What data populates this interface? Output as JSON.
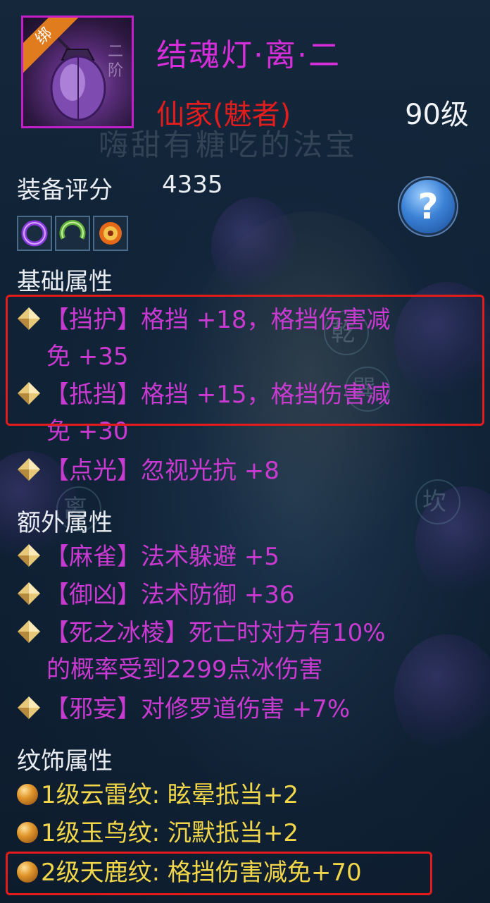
{
  "item": {
    "bind_tag": "绑",
    "name": "结魂灯·离·二",
    "class": "仙家(魅者)",
    "level": "90级",
    "watermark": "嗨甜有糖吃的法宝",
    "rank_glyph": "二阶",
    "rarity_color": "#c21fc8"
  },
  "score": {
    "label": "装备评分",
    "value": "4335"
  },
  "help": {
    "icon": "question-icon",
    "glyph": "?"
  },
  "gems": [
    {
      "icon": "purple-ring-gem-icon",
      "color": "#8a3be0"
    },
    {
      "icon": "green-ring-gem-icon",
      "color": "#5fae3a"
    },
    {
      "icon": "orange-orb-gem-icon",
      "color": "#e46a1a"
    }
  ],
  "base_section": {
    "title": "基础属性",
    "attrs": [
      {
        "line1": "【挡护】格挡 +18，格挡伤害减",
        "line2": "免 +35"
      },
      {
        "line1": "【抵挡】格挡 +15，格挡伤害减",
        "line2": "免 +30"
      },
      {
        "line1": "【点光】忽视光抗 +8",
        "line2": ""
      }
    ]
  },
  "extra_section": {
    "title": "额外属性",
    "attrs": [
      {
        "line1": "【麻雀】法术躲避 +5",
        "line2": ""
      },
      {
        "line1": "【御凶】法术防御 +36",
        "line2": ""
      },
      {
        "line1": "【死之冰棱】死亡时对方有10%",
        "line2": "的概率受到2299点冰伤害"
      },
      {
        "line1": "【邪妄】对修罗道伤害 +7%",
        "line2": ""
      }
    ]
  },
  "rune_section": {
    "title": "纹饰属性",
    "runes": [
      {
        "text": "1级云雷纹: 眩晕抵当+2"
      },
      {
        "text": "1级玉鸟纹: 沉默抵当+2"
      },
      {
        "text": "2级天鹿纹: 格挡伤害减免+70"
      }
    ]
  },
  "colors": {
    "attr": "#c83ad0",
    "rune": "#f1d64a",
    "class": "#e21d1d",
    "highlight": "#e21b1b"
  },
  "background_glyphs": [
    "乾",
    "巽",
    "离",
    "坎",
    "阶"
  ]
}
